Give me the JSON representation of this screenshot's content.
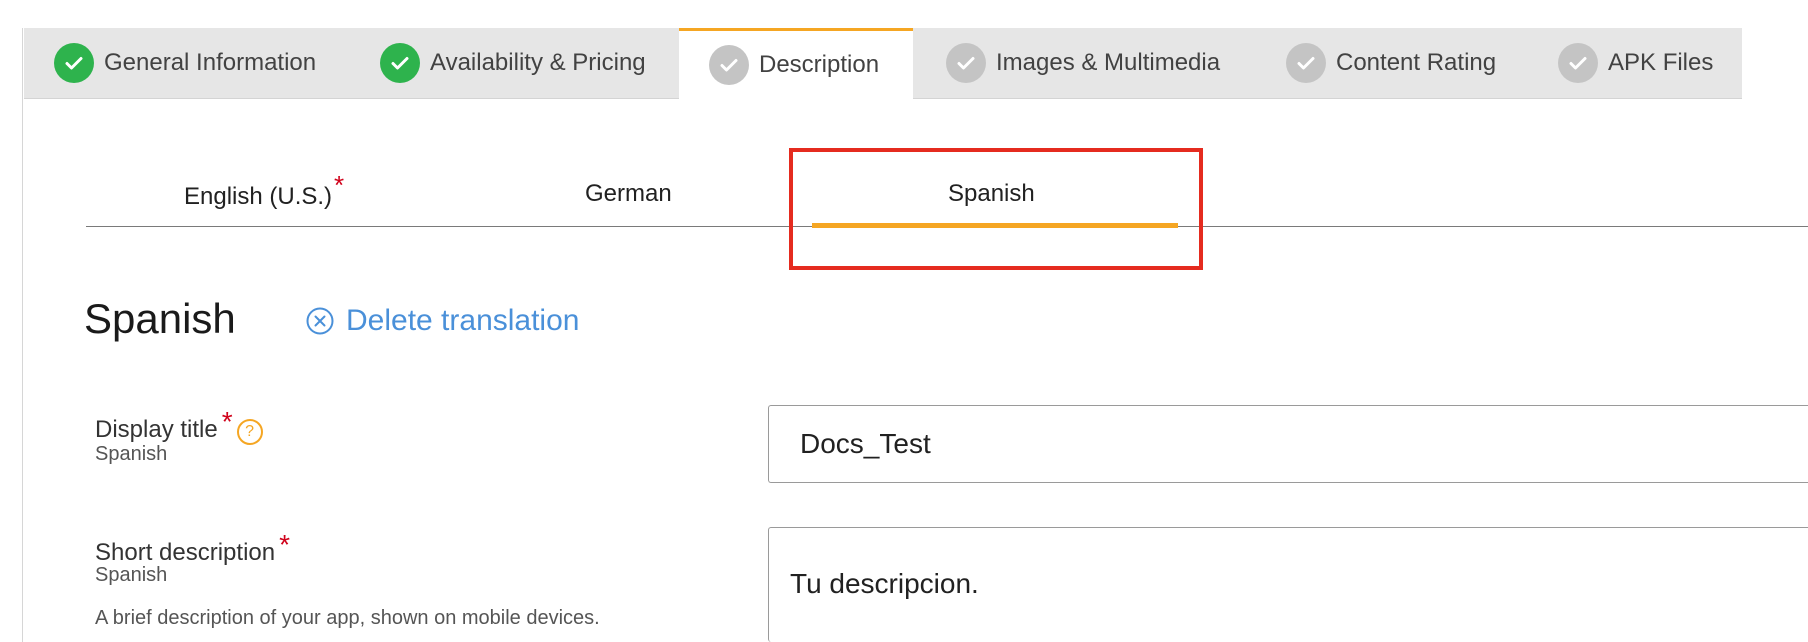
{
  "top_tabs": [
    {
      "label": "General Information",
      "status": "complete"
    },
    {
      "label": "Availability & Pricing",
      "status": "complete"
    },
    {
      "label": "Description",
      "status": "incomplete"
    },
    {
      "label": "Images & Multimedia",
      "status": "incomplete"
    },
    {
      "label": "Content Rating",
      "status": "incomplete"
    },
    {
      "label": "APK Files",
      "status": "incomplete"
    }
  ],
  "active_top_tab": "Description",
  "language_tabs": [
    {
      "label": "English (U.S.)",
      "required_marker": "*"
    },
    {
      "label": "German"
    },
    {
      "label": "Spanish"
    }
  ],
  "active_language": "Spanish",
  "section": {
    "title": "Spanish",
    "delete_label": "Delete translation"
  },
  "fields": {
    "display_title": {
      "label": "Display title",
      "required_marker": "*",
      "help_glyph": "?",
      "sub_label": "Spanish",
      "value": "Docs_Test"
    },
    "short_description": {
      "label": "Short description",
      "required_marker": "*",
      "sub_label": "Spanish",
      "hint": "A brief description of your app, shown on mobile devices.",
      "value": "Tu descripcion."
    }
  },
  "colors": {
    "accent_orange": "#f5a623",
    "complete_green": "#2eb34d",
    "incomplete_gray": "#c4c4c4",
    "link_blue": "#4a90d9",
    "required_red": "#d0021b",
    "highlight_red": "#e52b1f",
    "tab_bar_bg": "#e6e6e6"
  }
}
